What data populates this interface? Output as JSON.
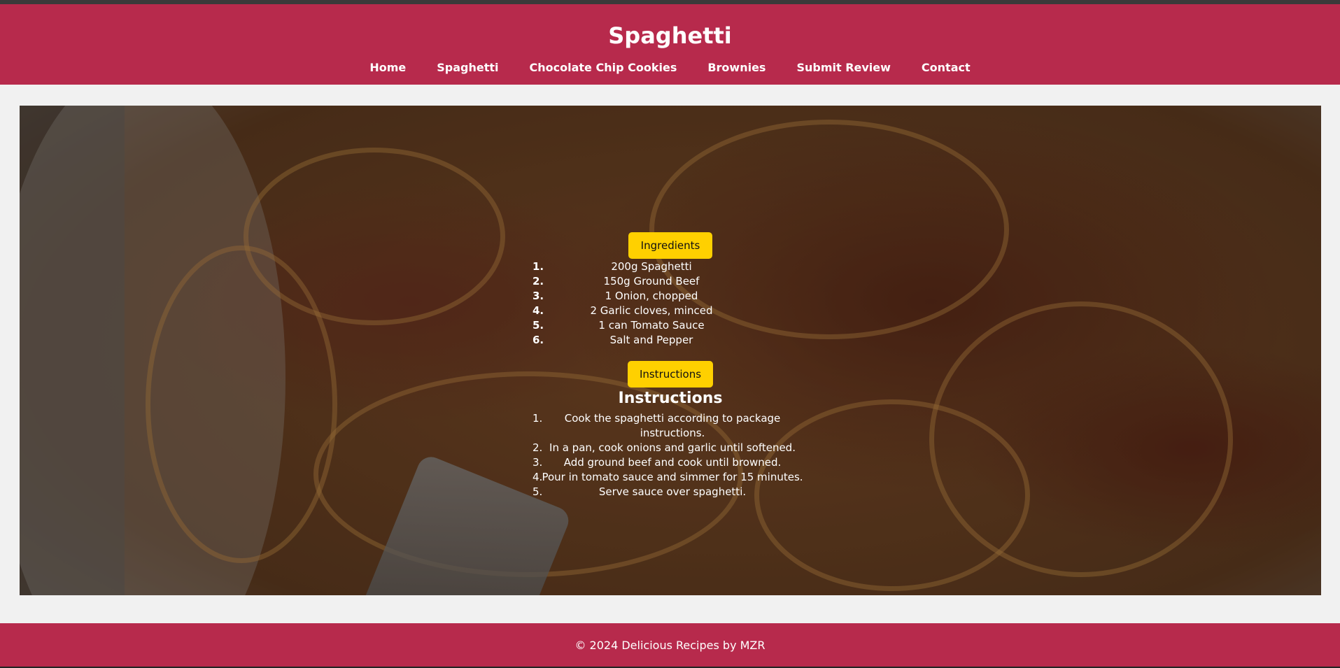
{
  "header": {
    "title": "Spaghetti",
    "nav": [
      "Home",
      "Spaghetti",
      "Chocolate Chip Cookies",
      "Brownies",
      "Submit Review",
      "Contact"
    ]
  },
  "recipe": {
    "ingredients_button": "Ingredients",
    "ingredients": [
      "200g Spaghetti",
      "150g Ground Beef",
      "1 Onion, chopped",
      "2 Garlic cloves, minced",
      "1 can Tomato Sauce",
      "Salt and Pepper"
    ],
    "instructions_button": "Instructions",
    "instructions_title": "Instructions",
    "instructions": [
      "Cook the spaghetti according to package instructions.",
      "In a pan, cook onions and garlic until softened.",
      "Add ground beef and cook until browned.",
      "Pour in tomato sauce and simmer for 15 minutes.",
      "Serve sauce over spaghetti."
    ]
  },
  "footer": {
    "text": "© 2024 Delicious Recipes by MZR"
  },
  "colors": {
    "brand": "#b72a4c",
    "button": "#ffd000",
    "background": "#f1f1f1"
  }
}
